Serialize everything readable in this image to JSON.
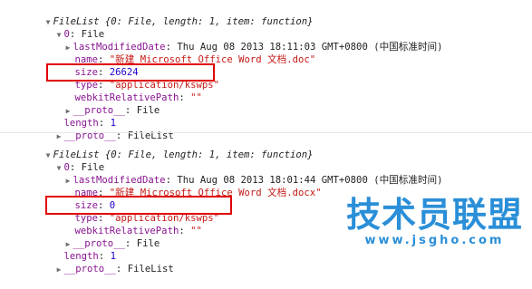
{
  "entries": [
    {
      "header": "FileList {0: File, length: 1, item: function}",
      "item_index": "0",
      "item_type": "File",
      "lastModifiedDate": "Thu Aug 08 2013 18:11:03 GMT+0800 (中国标准时间)",
      "name": "\"新建 Microsoft Office Word 文档.doc\"",
      "size": "26624",
      "type": "\"application/kswps\"",
      "webkitRelativePath": "\"\"",
      "proto_value": "File",
      "length": "1",
      "outer_proto_value": "FileList"
    },
    {
      "header": "FileList {0: File, length: 1, item: function}",
      "item_index": "0",
      "item_type": "File",
      "lastModifiedDate": "Thu Aug 08 2013 18:01:44 GMT+0800 (中国标准时间)",
      "name": "\"新建 Microsoft Office Word 文档.docx\"",
      "size": "0",
      "type": "\"application/kswps\"",
      "webkitRelativePath": "\"\"",
      "proto_value": "File",
      "length": "1",
      "outer_proto_value": "FileList"
    }
  ],
  "labels": {
    "lastModifiedDate": "lastModifiedDate",
    "name": "name",
    "size": "size",
    "type": "type",
    "webkitRelativePath": "webkitRelativePath",
    "proto": "__proto__",
    "length": "length"
  },
  "watermark": {
    "text": "技术员联盟",
    "url": "www.jsgho.com"
  },
  "colors": {
    "highlight": "#e00000",
    "property": "#881391",
    "string": "#c41a16",
    "number": "#1c00cf",
    "watermark": "#2a8fd8"
  }
}
